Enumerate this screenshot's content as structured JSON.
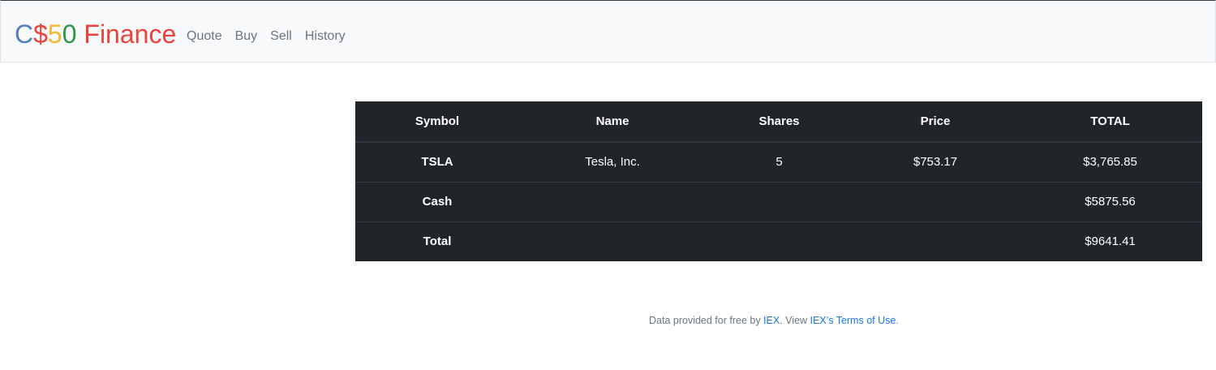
{
  "brand": {
    "c": "C",
    "dollar": "$",
    "five": "5",
    "zero": "0",
    "finance": " Finance"
  },
  "nav": {
    "items": [
      {
        "label": "Quote"
      },
      {
        "label": "Buy"
      },
      {
        "label": "Sell"
      },
      {
        "label": "History"
      }
    ]
  },
  "portfolio": {
    "headers": [
      "Symbol",
      "Name",
      "Shares",
      "Price",
      "TOTAL"
    ],
    "rows": [
      {
        "symbol": "TSLA",
        "name": "Tesla, Inc.",
        "shares": "5",
        "price": "$753.17",
        "total": "$3,765.85"
      }
    ],
    "cash": {
      "label": "Cash",
      "total": "$5875.56"
    },
    "grand": {
      "label": "Total",
      "total": "$9641.41"
    }
  },
  "footer": {
    "prefix": "Data provided for free by ",
    "iex_link": "IEX",
    "middle": ". View ",
    "terms_link": "IEX’s Terms of Use",
    "suffix": "."
  },
  "colors": {
    "brand_blue": "#537fbe",
    "brand_red": "#ea433b",
    "brand_yellow": "#f5b82e",
    "brand_green": "#2e944b",
    "table_bg": "#212529",
    "link": "#1a73e8"
  }
}
